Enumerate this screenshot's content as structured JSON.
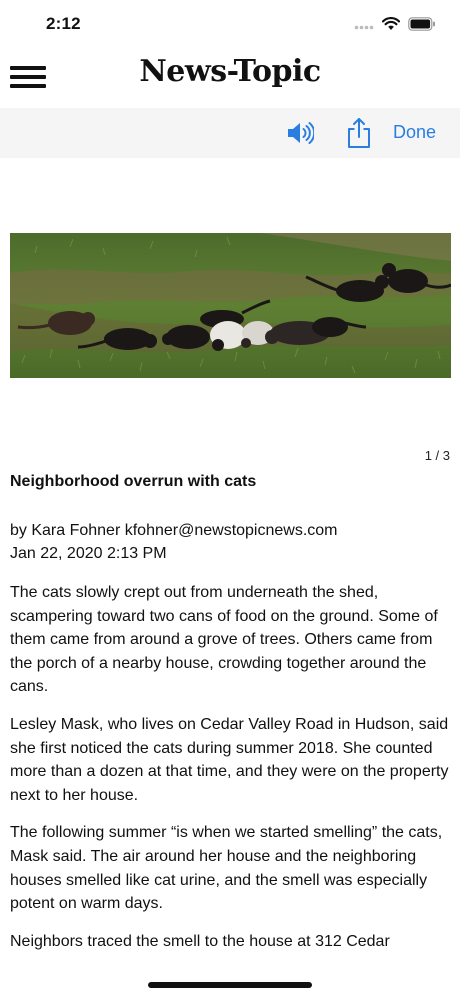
{
  "status_bar": {
    "time": "2:12"
  },
  "masthead": {
    "logo": "News-Topic",
    "menu_icon": "hamburger-menu-icon"
  },
  "toolbar": {
    "speaker_icon": "speaker-icon",
    "share_icon": "share-icon",
    "done_label": "Done",
    "accent_color": "#2a7de1"
  },
  "gallery": {
    "counter": "1 / 3"
  },
  "article": {
    "headline": "Neighborhood overrun with cats",
    "byline": "by Kara Fohner kfohner@newstopicnews.com",
    "dateline": "Jan 22, 2020 2:13 PM",
    "paragraphs": [
      "The cats slowly crept out from underneath the shed, scampering toward two cans of food on the ground. Some of them came from around a grove of trees. Others came from the porch of a nearby house, crowding together around the cans.",
      "Lesley Mask, who lives on Cedar Valley Road in Hudson, said she first noticed the cats during summer 2018. She counted more than a dozen at that time, and they were on the property next to her house.",
      "The following summer “is when we started smelling” the cats, Mask said. The air around her house and the neighboring houses smelled like cat urine, and the smell was especially potent on warm days.",
      "Neighbors traced the smell to the house at 312 Cedar"
    ]
  }
}
